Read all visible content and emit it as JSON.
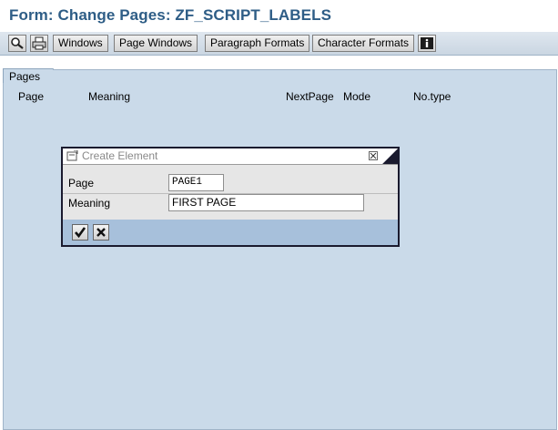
{
  "window": {
    "title": "Form: Change Pages: ZF_SCRIPT_LABELS"
  },
  "toolbar": {
    "icons": [
      "display-icon",
      "print-preview-icon"
    ],
    "buttons": [
      "Windows",
      "Page Windows",
      "Paragraph Formats",
      "Character Formats"
    ],
    "info_icon": "info-icon"
  },
  "pages_tab": {
    "label": "Pages",
    "columns": [
      "Page",
      "Meaning",
      "NextPage",
      "Mode",
      "No.type"
    ]
  },
  "dialog": {
    "title": "Create Element",
    "fields": [
      {
        "label": "Page",
        "value": "PAGE1"
      },
      {
        "label": "Meaning",
        "value": "FIRST PAGE"
      }
    ],
    "buttons": [
      "confirm-checkmark-icon",
      "cancel-x-icon"
    ]
  },
  "colors": {
    "title_text": "#2e5d86",
    "frame_bg": "#cadae9",
    "dialog_footer": "#a7c0db"
  }
}
